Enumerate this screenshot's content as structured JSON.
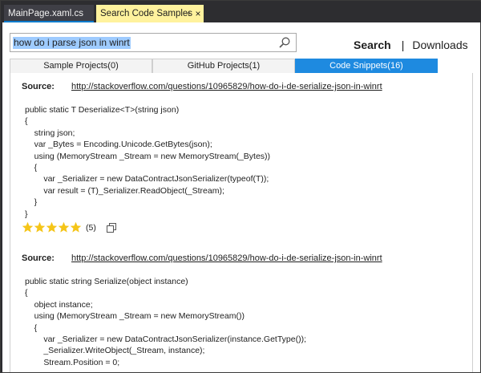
{
  "doc_tabs": {
    "inactive_label": "MainPage.xaml.cs",
    "active_label": "Search Code Samples",
    "pin_glyph": "⊣",
    "close_glyph": "×"
  },
  "search": {
    "value": "how do i parse json in winrt"
  },
  "top_nav": {
    "search_label": "Search",
    "separator": "|",
    "downloads_label": "Downloads"
  },
  "result_tabs": [
    {
      "label": "Sample Projects(0)",
      "selected": false
    },
    {
      "label": "GitHub Projects(1)",
      "selected": false
    },
    {
      "label": "Code Snippets(16)",
      "selected": true
    }
  ],
  "results": [
    {
      "source_label": "Source:",
      "source_url": "http://stackoverflow.com/questions/10965829/how-do-i-de-serialize-json-in-winrt",
      "code": "public static T Deserialize<T>(string json)\n{\n    string json;\n    var _Bytes = Encoding.Unicode.GetBytes(json);\n    using (MemoryStream _Stream = new MemoryStream(_Bytes))\n    {\n        var _Serializer = new DataContractJsonSerializer(typeof(T));\n        var result = (T)_Serializer.ReadObject(_Stream);\n    }\n}",
      "rating": 5,
      "rating_count": "(5)"
    },
    {
      "source_label": "Source:",
      "source_url": "http://stackoverflow.com/questions/10965829/how-do-i-de-serialize-json-in-winrt",
      "code": "public static string Serialize(object instance)\n{\n    object instance;\n    using (MemoryStream _Stream = new MemoryStream())\n    {\n        var _Serializer = new DataContractJsonSerializer(instance.GetType());\n        _Serializer.WriteObject(_Stream, instance);\n        Stream.Position = 0;"
    }
  ],
  "colors": {
    "active_tab_bg": "#fff29d",
    "selected_result_tab": "#1e8ae0",
    "search_highlight": "#9ecbff",
    "star": "#f5c518",
    "chrome": "#2d2d30"
  },
  "icons": {
    "search": "magnifier-icon",
    "copy": "copy-icon",
    "star": "star-icon"
  }
}
